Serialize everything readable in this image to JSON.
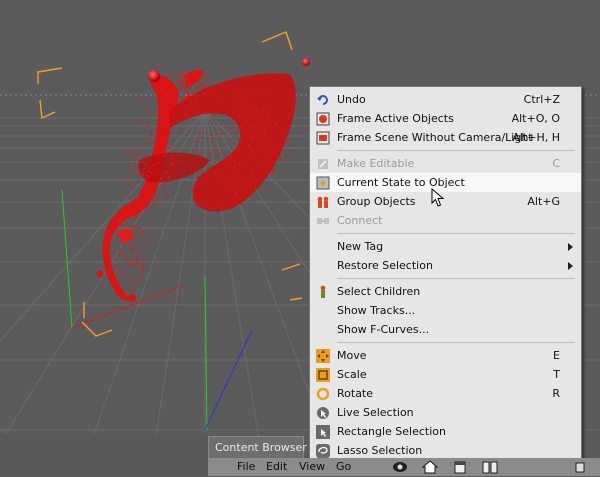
{
  "context_menu": {
    "items": [
      {
        "label": "Undo",
        "shortcut": "Ctrl+Z",
        "icon": "undo-icon"
      },
      {
        "label": "Frame Active Objects",
        "shortcut": "Alt+O, O",
        "icon": "frame-active-icon"
      },
      {
        "label": "Frame Scene Without Camera/Light",
        "shortcut": "Alt+H, H",
        "icon": "frame-scene-icon"
      },
      {
        "label": "Make Editable",
        "shortcut": "C",
        "icon": "make-editable-icon",
        "disabled": true
      },
      {
        "label": "Current State to Object",
        "shortcut": "",
        "icon": "current-state-icon",
        "highlighted": true
      },
      {
        "label": "Group Objects",
        "shortcut": "Alt+G",
        "icon": "group-objects-icon"
      },
      {
        "label": "Connect",
        "shortcut": "",
        "icon": "connect-icon",
        "disabled": true
      },
      {
        "label": "New Tag",
        "submenu": true
      },
      {
        "label": "Restore Selection",
        "submenu": true
      },
      {
        "label": "Select Children",
        "shortcut": "",
        "icon": "select-children-icon"
      },
      {
        "label": "Show Tracks...",
        "shortcut": ""
      },
      {
        "label": "Show F-Curves...",
        "shortcut": ""
      },
      {
        "label": "Move",
        "shortcut": "E",
        "icon": "move-icon"
      },
      {
        "label": "Scale",
        "shortcut": "T",
        "icon": "scale-icon"
      },
      {
        "label": "Rotate",
        "shortcut": "R",
        "icon": "rotate-icon"
      },
      {
        "label": "Live Selection",
        "shortcut": "",
        "icon": "live-selection-icon"
      },
      {
        "label": "Rectangle Selection",
        "shortcut": "",
        "icon": "rectangle-selection-icon"
      },
      {
        "label": "Lasso Selection",
        "shortcut": "",
        "icon": "lasso-selection-icon"
      }
    ]
  },
  "content_browser": {
    "tab_label": "Content Browser",
    "menus": [
      "File",
      "Edit",
      "View",
      "Go"
    ],
    "toolbar_icons": [
      "eye-icon",
      "home-icon",
      "preset-icon",
      "book-icon",
      "more-icon"
    ]
  },
  "colors": {
    "viewport_bg": "#5b5b5b",
    "grid_line": "#6b6b6b",
    "object_red": "#d81515",
    "bbox_orange": "#f0a020",
    "menu_bg": "#e6e6e6"
  }
}
